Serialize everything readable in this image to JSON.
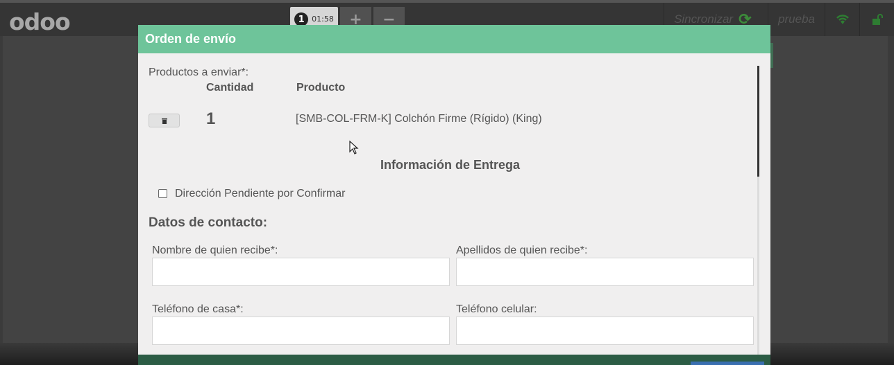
{
  "navbar": {
    "logo": "odoo",
    "order_number": "1",
    "order_time": "01:58",
    "add_label": "+",
    "remove_label": "−",
    "sync_label": "Sincronizar",
    "user_label": "prueba"
  },
  "modal": {
    "title": "Orden de envío",
    "products_label": "Productos a enviar*:",
    "col_quantity": "Cantidad",
    "col_product": "Producto",
    "product_row": {
      "quantity": "1",
      "product": "[SMB-COL-FRM-K] Colchón Firme (Rígido) (King)"
    },
    "delivery_title": "Información de Entrega",
    "pending_address_label": "Dirección Pendiente por Confirmar",
    "contact_title": "Datos de contacto:",
    "fields": {
      "first_name_label": "Nombre de quien recibe*:",
      "last_name_label": "Apellidos de quien recibe*:",
      "home_phone_label": "Teléfono de casa*:",
      "mobile_phone_label": "Teléfono celular:"
    }
  },
  "colors": {
    "header_green": "#6ec49a",
    "modal_bg": "#f0efef",
    "navbar_bg": "#353535"
  }
}
